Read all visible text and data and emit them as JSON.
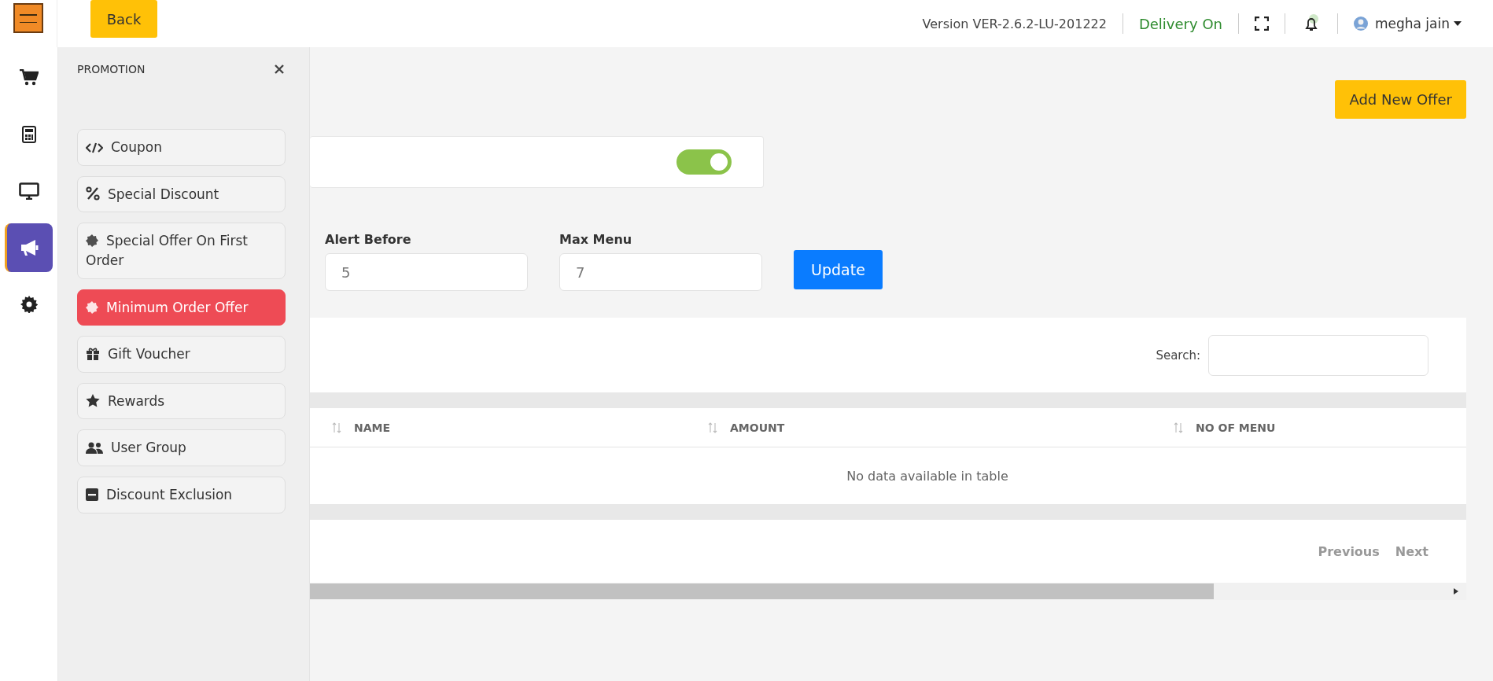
{
  "header": {
    "back_button": "Back",
    "version": "Version VER-2.6.2-LU-201222",
    "delivery_status": "Delivery On",
    "user_name": "megha jain"
  },
  "rail": {
    "items": [
      {
        "kind": "cart",
        "selected": false
      },
      {
        "kind": "calculator",
        "selected": false
      },
      {
        "kind": "monitor",
        "selected": false
      },
      {
        "kind": "megaphone",
        "selected": true
      },
      {
        "kind": "gear",
        "selected": false
      }
    ]
  },
  "promotion_panel": {
    "title": "PROMOTION",
    "items": [
      {
        "kind": "code",
        "label": "Coupon",
        "selected": false
      },
      {
        "kind": "percent",
        "label": "Special Discount",
        "selected": false
      },
      {
        "kind": "badge",
        "label": "Special Offer On First Order",
        "selected": false
      },
      {
        "kind": "badge",
        "label": "Minimum Order Offer",
        "selected": true
      },
      {
        "kind": "gift",
        "label": "Gift Voucher",
        "selected": false
      },
      {
        "kind": "star",
        "label": "Rewards",
        "selected": false
      },
      {
        "kind": "users",
        "label": "User Group",
        "selected": false
      },
      {
        "kind": "minus",
        "label": "Discount Exclusion",
        "selected": false
      }
    ]
  },
  "page": {
    "add_button": "Add New Offer",
    "toggle": {
      "on": true
    },
    "fields": [
      {
        "label": "Alert Before",
        "value": "5"
      },
      {
        "label": "Max Menu",
        "value": "7"
      }
    ],
    "update_button": "Update"
  },
  "table": {
    "search_label": "Search:",
    "columns": [
      "NAME",
      "AMOUNT",
      "NO OF MENU"
    ],
    "empty_message": "No data available in table",
    "pagination": [
      "Previous",
      "Next"
    ]
  }
}
